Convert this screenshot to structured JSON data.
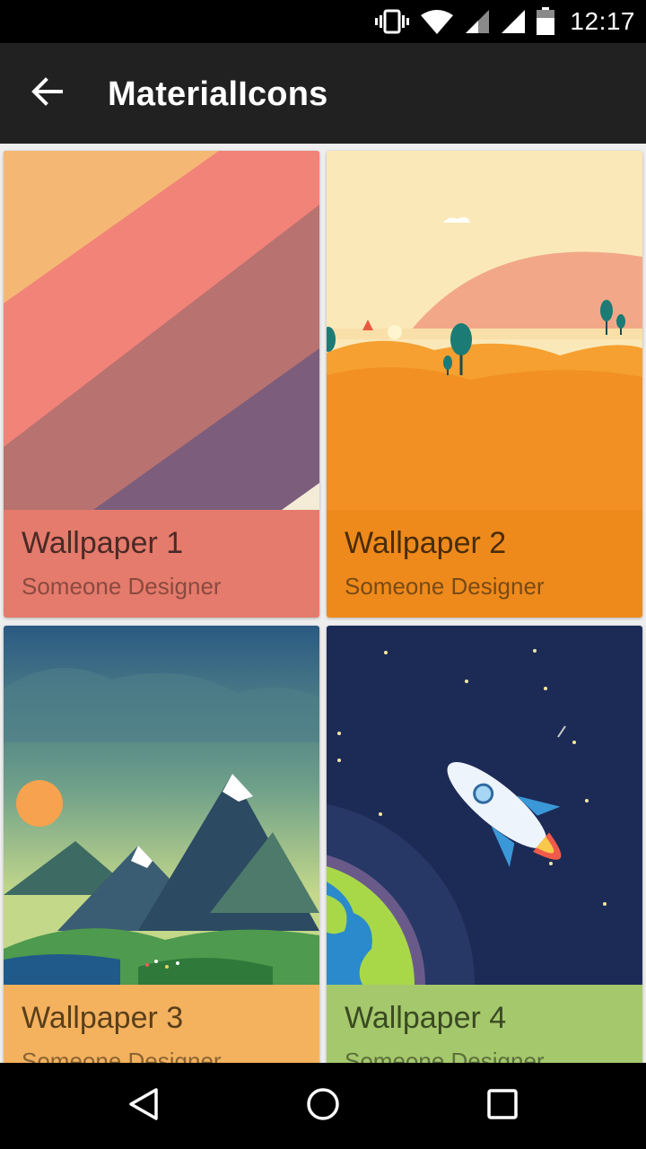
{
  "status_bar": {
    "time": "12:17",
    "icons": [
      "vibrate-icon",
      "wifi-icon",
      "signal-icon",
      "signal-icon",
      "battery-icon"
    ]
  },
  "app_bar": {
    "title": "MaterialIcons",
    "back_icon": "arrow-back-icon"
  },
  "wallpapers": [
    {
      "title": "Wallpaper 1",
      "author": "Someone Designer",
      "footer_color": "#e57b6c",
      "title_color": "#4a2a26",
      "author_color": "#8a4a40"
    },
    {
      "title": "Wallpaper 2",
      "author": "Someone Designer",
      "footer_color": "#ee8a1b",
      "title_color": "#4a2c0a",
      "author_color": "#7a4a15"
    },
    {
      "title": "Wallpaper 3",
      "author": "Someone Designer",
      "footer_color": "#f4b25f",
      "title_color": "#5a3f1a",
      "author_color": "#8a6230"
    },
    {
      "title": "Wallpaper 4",
      "author": "Someone Designer",
      "footer_color": "#a5c86c",
      "title_color": "#3a4a22",
      "author_color": "#5a6f3a"
    }
  ],
  "nav_bar": {
    "icons": [
      "back-triangle-icon",
      "home-circle-icon",
      "recents-square-icon"
    ]
  }
}
